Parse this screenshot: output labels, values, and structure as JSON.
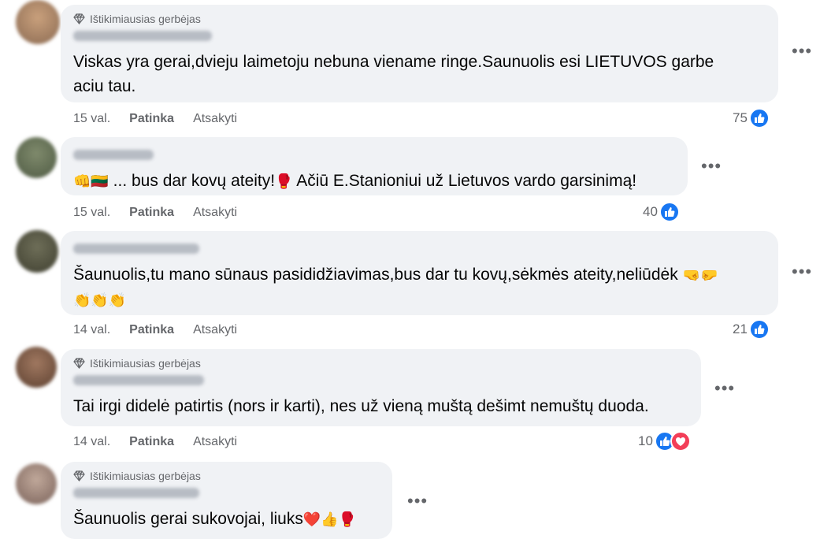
{
  "badge_label": "Ištikimiausias gerbėjas",
  "actions": {
    "like": "Patinka",
    "reply": "Atsakyti"
  },
  "more_icon": "more-horizontal-icon",
  "colors": {
    "bubble": "#f0f2f5",
    "like_blue": "#1877f2",
    "love_red": "#f33e58",
    "meta_gray": "#65676b"
  },
  "comments": [
    {
      "top_fan": true,
      "lines": [
        "Viskas yra gerai,dvieju laimetoju nebuna viename ringe.Saunuolis esi LIETUVOS garbe",
        "aciu tau."
      ],
      "time": "15 val.",
      "reaction_count": "75",
      "reactions": [
        "like"
      ]
    },
    {
      "top_fan": false,
      "prefix_emoji": "👊🇱🇹",
      "line1": " ... bus dar kovų ateity!",
      "glove": "🥊",
      "line1b": " Ačiū E.Stanioniui už Lietuvos vardo garsinimą!",
      "time": "15 val.",
      "reaction_count": "40",
      "reactions": [
        "like"
      ]
    },
    {
      "top_fan": false,
      "line1": "Šaunuolis,tu mano sūnaus pasididžiavimas,bus dar tu kovų,sėkmės ateity,neliūdėk ",
      "line1_emoji": "🤜🤛",
      "line2_emoji": "👏👏👏",
      "time": "14 val.",
      "reaction_count": "21",
      "reactions": [
        "like"
      ]
    },
    {
      "top_fan": true,
      "line1": "Tai irgi didelė patirtis (nors ir karti), nes už vieną muštą dešimt nemuštų duoda.",
      "time": "14 val.",
      "reaction_count": "10",
      "reactions": [
        "like",
        "love"
      ]
    },
    {
      "top_fan": true,
      "line1": "Šaunuolis gerai sukovojai, liuks",
      "line1_emoji": "❤️👍🥊"
    }
  ]
}
